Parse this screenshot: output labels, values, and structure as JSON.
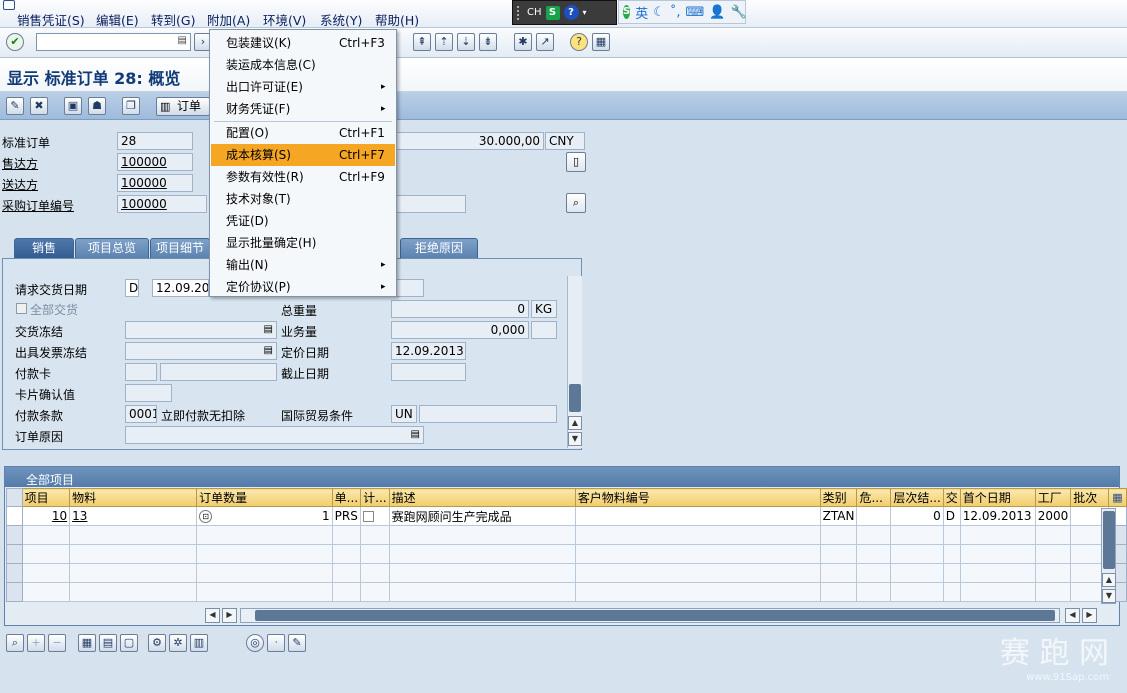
{
  "menu_bar": {
    "items": [
      "销售凭证(S)",
      "编辑(E)",
      "转到(G)",
      "附加(A)",
      "环境(V)",
      "系统(Y)",
      "帮助(H)"
    ]
  },
  "ime_bar": {
    "lang": "CH",
    "s_label": "S",
    "qmark": "?",
    "mode": "英",
    "icons": [
      "moon-icon",
      "comma-icon",
      "keyboard-icon",
      "wrench-icon"
    ]
  },
  "toolbar": {
    "command_value": ""
  },
  "page_title": "显示 标准订单 28: 概览",
  "toolbar2": {
    "order_btn_label": "订单"
  },
  "header_fields": {
    "std_order_label": "标准订单",
    "std_order_value": "28",
    "net_value": "30.000,00",
    "currency": "CNY",
    "sold_to_label": "售达方",
    "sold_to_value": "100000",
    "ship_to_label": "送达方",
    "ship_to_value": "100000",
    "po_label": "采购订单编号",
    "po_value": "100000"
  },
  "tabs": [
    "销售",
    "项目总览",
    "项目细节",
    "拒绝原因"
  ],
  "sales_tab": {
    "req_delivery_label": "请求交货日期",
    "req_delivery_type": "D",
    "req_delivery_date": "12.09.20",
    "full_delivery_label": "全部交货",
    "delivery_block_label": "交货冻结",
    "billing_block_label": "出具发票冻结",
    "payment_card_label": "付款卡",
    "card_verify_label": "卡片确认值",
    "payment_terms_label": "付款条款",
    "payment_terms_code": "0001",
    "payment_terms_text": "立即付款无扣除",
    "order_reason_label": "订单原因",
    "total_weight_label": "总重量",
    "total_weight_value": "0",
    "weight_unit": "KG",
    "volume_label": "业务量",
    "volume_value": "0,000",
    "pricing_date_label": "定价日期",
    "pricing_date_value": "12.09.2013",
    "cutoff_date_label": "截止日期",
    "incoterms_label": "国际贸易条件",
    "incoterms_value": "UN"
  },
  "items_section": {
    "title": "全部项目",
    "columns": [
      "项目",
      "物料",
      "订单数量",
      "单...",
      "计...",
      "描述",
      "客户物料编号",
      "类别",
      "危...",
      "层次结...",
      "交",
      "首个日期",
      "工厂",
      "批次"
    ],
    "rows": [
      {
        "item": "10",
        "material": "13",
        "qty": "1",
        "unit": "PRS",
        "desc": "赛跑网顾问生产完成品",
        "cust_mat": "",
        "category": "ZTAN",
        "hazard": "",
        "hier": "0",
        "deliv": "D",
        "first_date": "12.09.2013",
        "plant": "2000",
        "batch": ""
      }
    ]
  },
  "dropdown_menu": {
    "items": [
      {
        "label": "包装建议(K)",
        "shortcut": "Ctrl+F3",
        "submenu": false
      },
      {
        "label": "装运成本信息(C)",
        "shortcut": "",
        "submenu": false
      },
      {
        "label": "出口许可证(E)",
        "shortcut": "",
        "submenu": true
      },
      {
        "label": "财务凭证(F)",
        "shortcut": "",
        "submenu": true
      },
      {
        "label": "配置(O)",
        "shortcut": "Ctrl+F1",
        "submenu": false
      },
      {
        "label": "成本核算(S)",
        "shortcut": "Ctrl+F7",
        "submenu": false
      },
      {
        "label": "参数有效性(R)",
        "shortcut": "Ctrl+F9",
        "submenu": false
      },
      {
        "label": "技术对象(T)",
        "shortcut": "",
        "submenu": false
      },
      {
        "label": "凭证(D)",
        "shortcut": "",
        "submenu": false
      },
      {
        "label": "显示批量确定(H)",
        "shortcut": "",
        "submenu": false
      },
      {
        "label": "输出(N)",
        "shortcut": "",
        "submenu": true
      },
      {
        "label": "定价协议(P)",
        "shortcut": "",
        "submenu": true
      }
    ],
    "highlighted_index": 5
  },
  "watermark": {
    "title": "赛 跑 网",
    "url": "www.91Sap.com"
  }
}
